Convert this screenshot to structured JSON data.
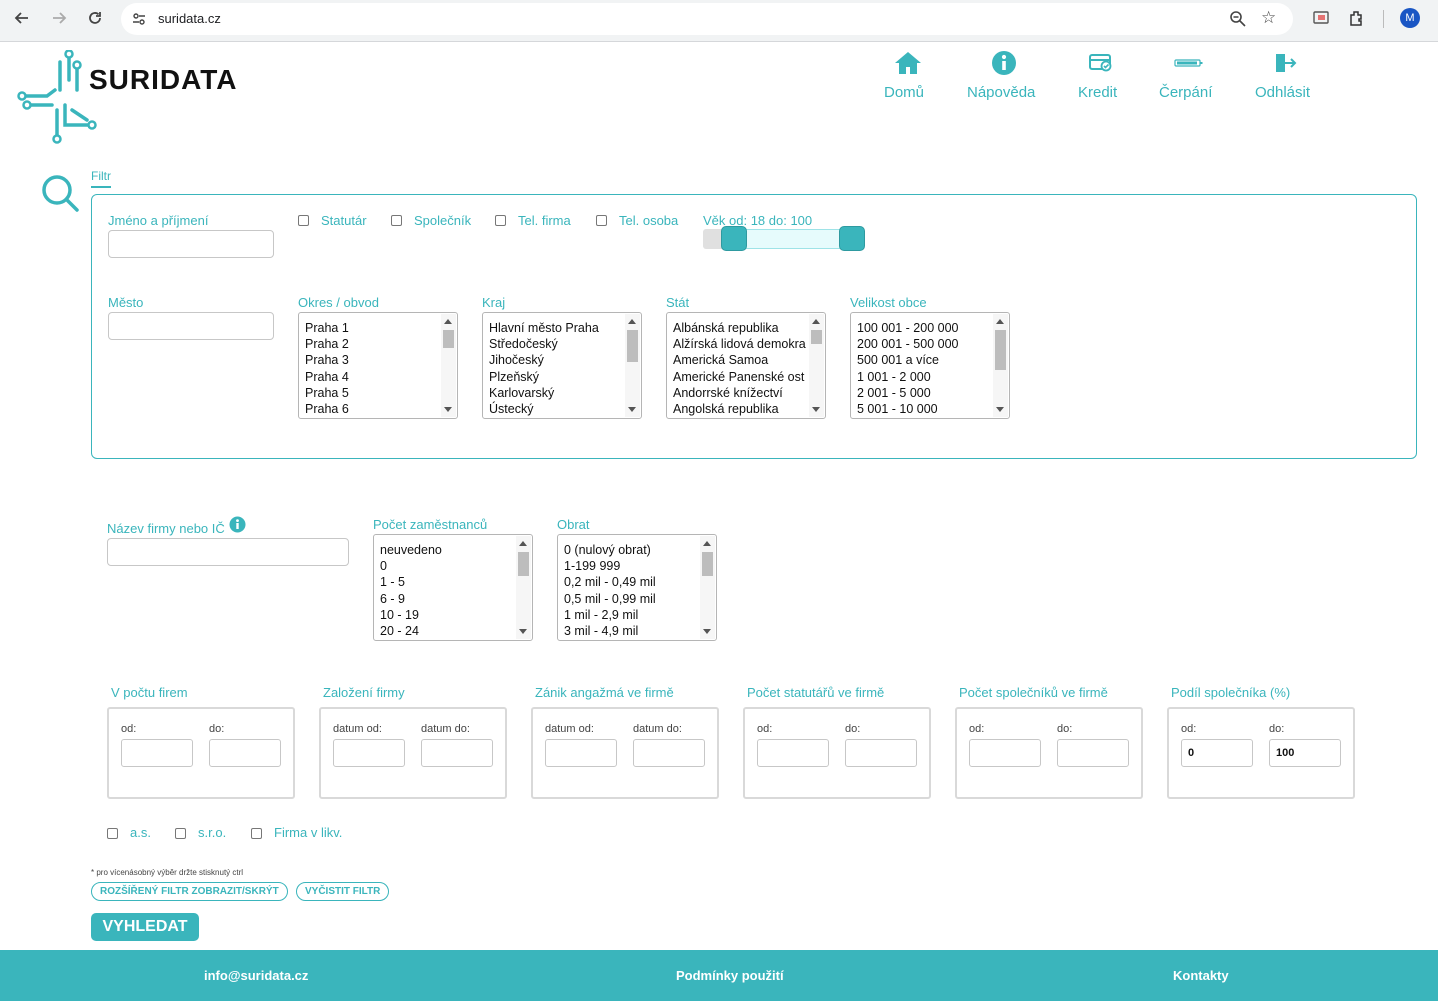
{
  "browser": {
    "url": "suridata.cz",
    "avatar_letter": "M"
  },
  "header": {
    "logo_text": "SURIDATA",
    "nav": [
      {
        "label": "Domů",
        "icon": "home-icon"
      },
      {
        "label": "Nápověda",
        "icon": "info-icon"
      },
      {
        "label": "Kredit",
        "icon": "credit-card-icon"
      },
      {
        "label": "Čerpání",
        "icon": "battery-icon"
      },
      {
        "label": "Odhlásit",
        "icon": "logout-icon"
      }
    ]
  },
  "filter": {
    "tab_label": "Filtr",
    "name_label": "Jméno a příjmení",
    "checks": [
      "Statutár",
      "Společník",
      "Tel. firma",
      "Tel. osoba"
    ],
    "age_label": "Věk od: 18 do: 100",
    "age_range": {
      "min": 0,
      "max": 120,
      "from": 18,
      "to": 100
    },
    "city_label": "Město",
    "district": {
      "label": "Okres / obvod",
      "options": [
        "Praha 1",
        "Praha 2",
        "Praha 3",
        "Praha 4",
        "Praha 5",
        "Praha 6"
      ]
    },
    "region": {
      "label": "Kraj",
      "options": [
        "Hlavní město Praha",
        "Středočeský",
        "Jihočeský",
        "Plzeňský",
        "Karlovarský",
        "Ústecký"
      ]
    },
    "country": {
      "label": "Stát",
      "options": [
        "Albánská republika",
        "Alžírská lidová demokra",
        "Americká Samoa",
        "Americké Panenské ost",
        "Andorrské knížectví",
        "Angolská republika"
      ]
    },
    "municipality_size": {
      "label": "Velikost obce",
      "options": [
        "100 001 - 200 000",
        "200 001 - 500 000",
        "500 001 a více",
        "1 001 - 2 000",
        "2 001 - 5 000",
        "5 001 - 10 000"
      ]
    }
  },
  "company": {
    "name_label": "Název firmy nebo IČ",
    "employees": {
      "label": "Počet zaměstnanců",
      "options": [
        "neuvedeno",
        "0",
        "1 - 5",
        "6 - 9",
        "10 - 19",
        "20 - 24"
      ]
    },
    "turnover": {
      "label": "Obrat",
      "options": [
        "0 (nulový obrat)",
        "1-199 999",
        "0,2 mil - 0,49 mil",
        "0,5 mil - 0,99 mil",
        "1 mil - 2,9 mil",
        "3 mil - 4,9 mil"
      ]
    }
  },
  "ranges": [
    {
      "label": "V počtu firem",
      "from_label": "od:",
      "to_label": "do:",
      "from_value": "",
      "to_value": ""
    },
    {
      "label": "Založení firmy",
      "from_label": "datum od:",
      "to_label": "datum do:",
      "from_value": "",
      "to_value": ""
    },
    {
      "label": "Zánik angažmá ve firmě",
      "from_label": "datum od:",
      "to_label": "datum do:",
      "from_value": "",
      "to_value": ""
    },
    {
      "label": "Počet statutářů ve firmě",
      "from_label": "od:",
      "to_label": "do:",
      "from_value": "",
      "to_value": ""
    },
    {
      "label": "Počet společníků ve firmě",
      "from_label": "od:",
      "to_label": "do:",
      "from_value": "",
      "to_value": ""
    },
    {
      "label": "Podíl společníka (%)",
      "from_label": "od:",
      "to_label": "do:",
      "from_value": "0",
      "to_value": "100"
    }
  ],
  "legal_forms": [
    "a.s.",
    "s.r.o.",
    "Firma v likv."
  ],
  "note": "* pro vícenásobný výběr držte stisknutý ctrl",
  "buttons": {
    "toggle_filter": "ROZŠÍŘENÝ FILTR ZOBRAZIT/SKRÝT",
    "clear_filter": "VYČISTIT FILTR",
    "search": "VYHLEDAT"
  },
  "footer": {
    "email": "info@suridata.cz",
    "terms": "Podmínky použití",
    "contacts": "Kontakty"
  },
  "colors": {
    "accent": "#3ab5bc"
  }
}
